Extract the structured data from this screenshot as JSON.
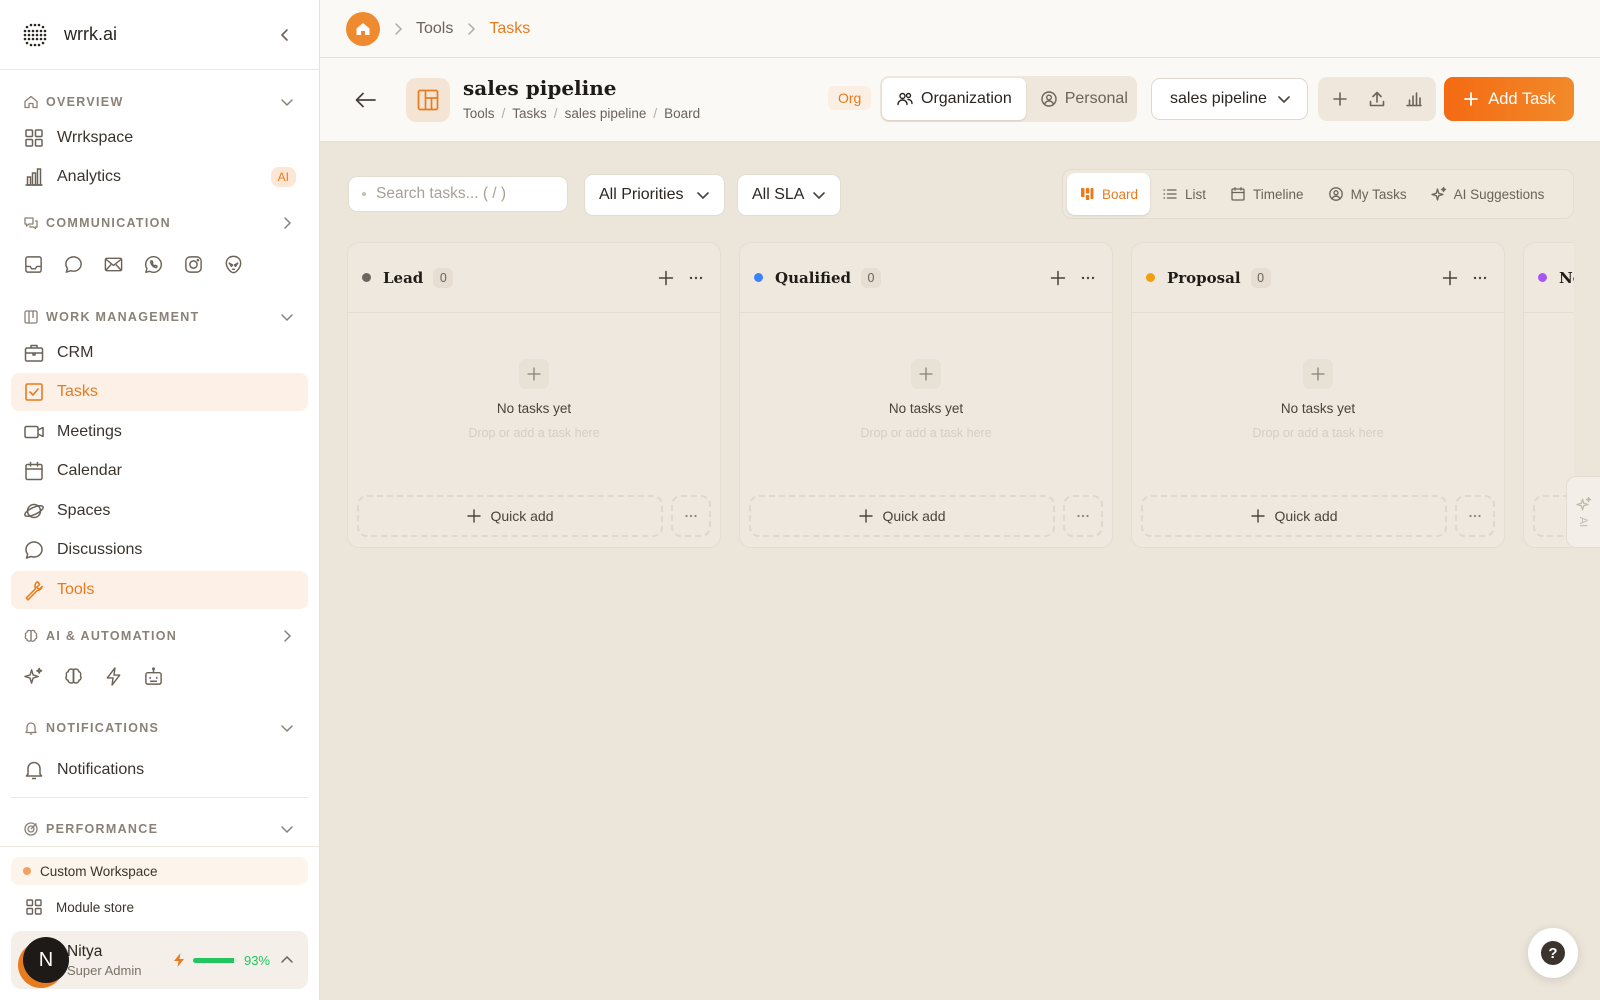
{
  "brand": {
    "name": "wrrk.ai"
  },
  "sidebar": {
    "overview": {
      "title": "OVERVIEW",
      "items": [
        {
          "label": "Wrrkspace"
        },
        {
          "label": "Analytics",
          "badge": "AI"
        }
      ]
    },
    "communication": {
      "title": "COMMUNICATION",
      "icons": [
        "inbox-icon",
        "chat-bubble-icon",
        "mail-icon",
        "whatsapp-icon",
        "instagram-icon",
        "alien-icon"
      ]
    },
    "work_management": {
      "title": "WORK MANAGEMENT",
      "items": [
        {
          "label": "CRM"
        },
        {
          "label": "Tasks",
          "active": true
        },
        {
          "label": "Meetings"
        },
        {
          "label": "Calendar"
        },
        {
          "label": "Spaces"
        },
        {
          "label": "Discussions"
        },
        {
          "label": "Tools",
          "active": true
        }
      ]
    },
    "ai_automation": {
      "title": "AI & AUTOMATION",
      "icons": [
        "sparkles-icon",
        "brain-icon",
        "lightning-icon",
        "robot-icon"
      ]
    },
    "notifications": {
      "title": "NOTIFICATIONS",
      "items": [
        {
          "label": "Notifications"
        }
      ]
    },
    "performance": {
      "title": "PERFORMANCE"
    },
    "custom_workspace": "Custom Workspace",
    "module_store": "Module store",
    "user": {
      "initial": "N",
      "name": "Nitya",
      "role": "Super Admin",
      "energy_percent": 93,
      "energy_label": "93%"
    }
  },
  "topbar": {
    "breadcrumbs": [
      "Tools",
      "Tasks"
    ]
  },
  "header": {
    "title": "sales pipeline",
    "sub_breadcrumbs": [
      "Tools",
      "Tasks",
      "sales pipeline",
      "Board"
    ],
    "org_pill": "Org",
    "scope_options": [
      {
        "label": "Organization",
        "active": true
      },
      {
        "label": "Personal",
        "active": false
      }
    ],
    "pipeline_select": "sales pipeline",
    "add_task_label": "Add Task"
  },
  "toolbar": {
    "search_placeholder": "Search tasks... ( / )",
    "priority_filter": "All Priorities",
    "sla_filter": "All SLA",
    "views": [
      {
        "label": "Board",
        "active": true
      },
      {
        "label": "List"
      },
      {
        "label": "Timeline"
      },
      {
        "label": "My Tasks"
      },
      {
        "label": "AI Suggestions"
      }
    ]
  },
  "board": {
    "columns": [
      {
        "title": "Lead",
        "count": "0",
        "color": "#6b6560"
      },
      {
        "title": "Qualified",
        "count": "0",
        "color": "#3b82f6"
      },
      {
        "title": "Proposal",
        "count": "0",
        "color": "#f59e0b"
      },
      {
        "title": "Ne",
        "count": "",
        "color": "#a855f7"
      }
    ],
    "empty_title": "No tasks yet",
    "empty_subtitle": "Drop or add a task here",
    "quick_add_label": "Quick add"
  },
  "ai_tab": {
    "label": "AI"
  },
  "help": {
    "label": "?"
  },
  "colors": {
    "accent": "#e77b1f",
    "accent_bg": "#fdf0e6",
    "success": "#22c55e"
  }
}
